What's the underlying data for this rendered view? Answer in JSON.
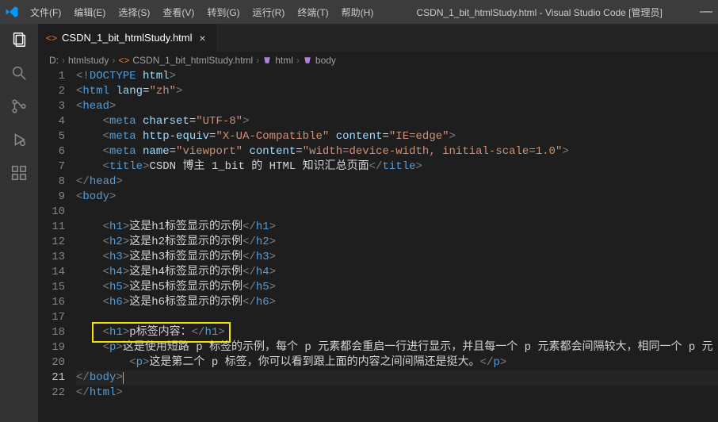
{
  "titlebar": {
    "menus": [
      "文件(F)",
      "编辑(E)",
      "选择(S)",
      "查看(V)",
      "转到(G)",
      "运行(R)",
      "终端(T)",
      "帮助(H)"
    ],
    "title": "CSDN_1_bit_htmlStudy.html - Visual Studio Code [管理员]"
  },
  "tab": {
    "filename": "CSDN_1_bit_htmlStudy.html"
  },
  "breadcrumb": {
    "parts": [
      "D:",
      "htmlstudy",
      "CSDN_1_bit_htmlStudy.html",
      "html",
      "body"
    ]
  },
  "editor": {
    "active_line": 21,
    "highlight_line": 18,
    "lines": [
      {
        "n": 1,
        "seg": [
          [
            "grey",
            "<!"
          ],
          [
            "blue",
            "DOCTYPE"
          ],
          [
            "txt",
            " "
          ],
          [
            "lblue",
            "html"
          ],
          [
            "grey",
            ">"
          ]
        ],
        "indent": 0
      },
      {
        "n": 2,
        "seg": [
          [
            "grey",
            "<"
          ],
          [
            "blue",
            "html"
          ],
          [
            "txt",
            " "
          ],
          [
            "lblue",
            "lang"
          ],
          [
            "txt",
            "="
          ],
          [
            "str",
            "\"zh\""
          ],
          [
            "grey",
            ">"
          ]
        ],
        "indent": 0
      },
      {
        "n": 3,
        "seg": [
          [
            "grey",
            "<"
          ],
          [
            "blue",
            "head"
          ],
          [
            "grey",
            ">"
          ]
        ],
        "indent": 0
      },
      {
        "n": 4,
        "seg": [
          [
            "grey",
            "<"
          ],
          [
            "blue",
            "meta"
          ],
          [
            "txt",
            " "
          ],
          [
            "lblue",
            "charset"
          ],
          [
            "txt",
            "="
          ],
          [
            "str",
            "\"UTF-8\""
          ],
          [
            "grey",
            ">"
          ]
        ],
        "indent": 1
      },
      {
        "n": 5,
        "seg": [
          [
            "grey",
            "<"
          ],
          [
            "blue",
            "meta"
          ],
          [
            "txt",
            " "
          ],
          [
            "lblue",
            "http-equiv"
          ],
          [
            "txt",
            "="
          ],
          [
            "str",
            "\"X-UA-Compatible\""
          ],
          [
            "txt",
            " "
          ],
          [
            "lblue",
            "content"
          ],
          [
            "txt",
            "="
          ],
          [
            "str",
            "\"IE=edge\""
          ],
          [
            "grey",
            ">"
          ]
        ],
        "indent": 1
      },
      {
        "n": 6,
        "seg": [
          [
            "grey",
            "<"
          ],
          [
            "blue",
            "meta"
          ],
          [
            "txt",
            " "
          ],
          [
            "lblue",
            "name"
          ],
          [
            "txt",
            "="
          ],
          [
            "str",
            "\"viewport\""
          ],
          [
            "txt",
            " "
          ],
          [
            "lblue",
            "content"
          ],
          [
            "txt",
            "="
          ],
          [
            "str",
            "\"width=device-width, initial-scale=1.0\""
          ],
          [
            "grey",
            ">"
          ]
        ],
        "indent": 1
      },
      {
        "n": 7,
        "seg": [
          [
            "grey",
            "<"
          ],
          [
            "blue",
            "title"
          ],
          [
            "grey",
            ">"
          ],
          [
            "txt",
            "CSDN 博主 1_bit 的 HTML 知识汇总页面"
          ],
          [
            "grey",
            "</"
          ],
          [
            "blue",
            "title"
          ],
          [
            "grey",
            ">"
          ]
        ],
        "indent": 1
      },
      {
        "n": 8,
        "seg": [
          [
            "grey",
            "</"
          ],
          [
            "blue",
            "head"
          ],
          [
            "grey",
            ">"
          ]
        ],
        "indent": 0
      },
      {
        "n": 9,
        "seg": [
          [
            "grey",
            "<"
          ],
          [
            "blue",
            "body"
          ],
          [
            "grey",
            ">"
          ]
        ],
        "indent": 0
      },
      {
        "n": 10,
        "seg": [],
        "indent": 0
      },
      {
        "n": 11,
        "seg": [
          [
            "grey",
            "<"
          ],
          [
            "blue",
            "h1"
          ],
          [
            "grey",
            ">"
          ],
          [
            "txt",
            "这是h1标签显示的示例"
          ],
          [
            "grey",
            "</"
          ],
          [
            "blue",
            "h1"
          ],
          [
            "grey",
            ">"
          ]
        ],
        "indent": 1
      },
      {
        "n": 12,
        "seg": [
          [
            "grey",
            "<"
          ],
          [
            "blue",
            "h2"
          ],
          [
            "grey",
            ">"
          ],
          [
            "txt",
            "这是h2标签显示的示例"
          ],
          [
            "grey",
            "</"
          ],
          [
            "blue",
            "h2"
          ],
          [
            "grey",
            ">"
          ]
        ],
        "indent": 1
      },
      {
        "n": 13,
        "seg": [
          [
            "grey",
            "<"
          ],
          [
            "blue",
            "h3"
          ],
          [
            "grey",
            ">"
          ],
          [
            "txt",
            "这是h3标签显示的示例"
          ],
          [
            "grey",
            "</"
          ],
          [
            "blue",
            "h3"
          ],
          [
            "grey",
            ">"
          ]
        ],
        "indent": 1
      },
      {
        "n": 14,
        "seg": [
          [
            "grey",
            "<"
          ],
          [
            "blue",
            "h4"
          ],
          [
            "grey",
            ">"
          ],
          [
            "txt",
            "这是h4标签显示的示例"
          ],
          [
            "grey",
            "</"
          ],
          [
            "blue",
            "h4"
          ],
          [
            "grey",
            ">"
          ]
        ],
        "indent": 1
      },
      {
        "n": 15,
        "seg": [
          [
            "grey",
            "<"
          ],
          [
            "blue",
            "h5"
          ],
          [
            "grey",
            ">"
          ],
          [
            "txt",
            "这是h5标签显示的示例"
          ],
          [
            "grey",
            "</"
          ],
          [
            "blue",
            "h5"
          ],
          [
            "grey",
            ">"
          ]
        ],
        "indent": 1
      },
      {
        "n": 16,
        "seg": [
          [
            "grey",
            "<"
          ],
          [
            "blue",
            "h6"
          ],
          [
            "grey",
            ">"
          ],
          [
            "txt",
            "这是h6标签显示的示例"
          ],
          [
            "grey",
            "</"
          ],
          [
            "blue",
            "h6"
          ],
          [
            "grey",
            ">"
          ]
        ],
        "indent": 1
      },
      {
        "n": 17,
        "seg": [],
        "indent": 0
      },
      {
        "n": 18,
        "seg": [
          [
            "grey",
            "<"
          ],
          [
            "blue",
            "h1"
          ],
          [
            "grey",
            ">"
          ],
          [
            "txt",
            "p标签内容："
          ],
          [
            "grey",
            "</"
          ],
          [
            "blue",
            "h1"
          ],
          [
            "grey",
            ">"
          ]
        ],
        "indent": 1
      },
      {
        "n": 19,
        "seg": [
          [
            "grey",
            "<"
          ],
          [
            "blue",
            "p"
          ],
          [
            "grey",
            ">"
          ],
          [
            "txt",
            "这是使用短路 p 标签的示例，每个 p 元素都会重启一行进行显示，并且每一个 p 元素都会间隔较大，相同一个 p 元"
          ]
        ],
        "indent": 1
      },
      {
        "n": 20,
        "seg": [
          [
            "grey",
            "<"
          ],
          [
            "blue",
            "p"
          ],
          [
            "grey",
            ">"
          ],
          [
            "txt",
            "这是第二个 p 标签，你可以看到跟上面的内容之间间隔还是挺大。"
          ],
          [
            "grey",
            "</"
          ],
          [
            "blue",
            "p"
          ],
          [
            "grey",
            ">"
          ]
        ],
        "indent": 2
      },
      {
        "n": 21,
        "seg": [
          [
            "grey",
            "</"
          ],
          [
            "blue",
            "body"
          ],
          [
            "grey",
            ">"
          ],
          [
            "cursor",
            ""
          ]
        ],
        "indent": 0,
        "active": true
      },
      {
        "n": 22,
        "seg": [
          [
            "grey",
            "</"
          ],
          [
            "blue",
            "html"
          ],
          [
            "grey",
            ">"
          ]
        ],
        "indent": 0
      }
    ]
  }
}
